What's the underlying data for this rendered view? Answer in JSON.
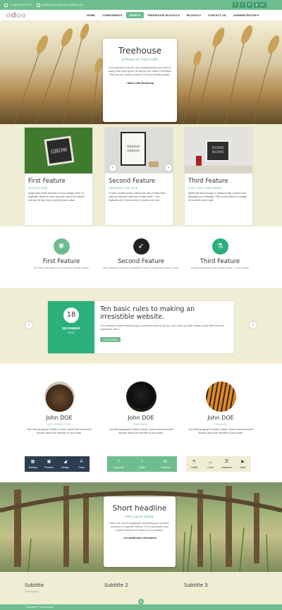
{
  "topbar": {
    "phone": "+1 (650) 691-3277",
    "email": "info@yourcompany.example.com",
    "language": "EN"
  },
  "navbar": {
    "logo_o1": "o",
    "logo_d": "d",
    "logo_rest": "oo",
    "menu": [
      {
        "label": "HOME"
      },
      {
        "label": "COMPONENTS"
      },
      {
        "label": "DEMO ▾"
      },
      {
        "label": "TREEHOUSE BLOCKS ▾"
      },
      {
        "label": "BLOCKS ▾"
      },
      {
        "label": "CONTACT US"
      },
      {
        "label": "ADMINISTRATOR ▾"
      }
    ]
  },
  "hero": {
    "title": "Treehouse",
    "subtitle": "A theme for Odoo CMS",
    "text": "Just drag and drop the new building blocks you need to easily build your layout. All layouts are made of sections, that you can easily combine to fit your specific project.",
    "made_with": "• Made with Bootstrap"
  },
  "features1": {
    "cards": [
      {
        "title": "First Feature",
        "subtitle": "Tell your story",
        "text": "Adapt these three columns to fit you design need. To duplicate, delete or move columns, select the column and use the top icons to perform your action.",
        "img_text": "GROW"
      },
      {
        "title": "Second Feature",
        "subtitle": "Showcase your work",
        "text": "To add a fourth column, reduce the size of these three columns using the right icon of each block. Then, duplicate one of the column to create a new one.",
        "img_text1": "limited",
        "img_text2": "edition"
      },
      {
        "title": "Third Feature",
        "subtitle": "Give some extra details",
        "text": "Delete the above image or replace it with a picture that illustrates your message. Click on the picture to change it's rounded corner style.",
        "img_text1": "HOME",
        "img_text2": "HOME"
      }
    ]
  },
  "features2": {
    "items": [
      {
        "title": "First Feature",
        "text": "Tell what's the value for the customer for this feature.",
        "color": "#6ebd8f",
        "icon": "bug-icon"
      },
      {
        "title": "Second Feature",
        "text": "Write what the customer would like to know, not what you want to show.",
        "color": "#222222",
        "icon": "rocket-icon"
      },
      {
        "title": "Third Feature",
        "text": "A small explanation of this great feature, in clear words.",
        "color": "#2bb07b",
        "icon": "flask-icon"
      }
    ]
  },
  "event": {
    "day": "18",
    "month": "DECEMBER",
    "year": "2014",
    "title": "Ten basic rules to making an irresistible website.",
    "text": "Your website is where almost all your customers will end up first. Let's clean up what it takes to give them the best experience with it.",
    "button": "FULL READ"
  },
  "team": {
    "members": [
      {
        "name": "John DOE",
        "role": "- ART DIRECTOR -",
        "text": "Use this paragraph to write a short, sweet and successful resume about the member of your team."
      },
      {
        "name": "John DOE",
        "role": "- PARTNER -",
        "text": "Use this paragraph to write a short, sweet and successful resume about the member of your team."
      },
      {
        "name": "John DOE",
        "role": "- TRAINEE -",
        "text": "Use this paragraph to write a short, sweet and successful resume about the member of your team."
      }
    ],
    "bar1": [
      {
        "label": "Briefing",
        "icon": "briefcase-icon",
        "glyph": "▦"
      },
      {
        "label": "Pictures",
        "icon": "picture-icon",
        "glyph": "▣"
      },
      {
        "label": "Design",
        "icon": "design-icon",
        "glyph": "◢"
      },
      {
        "label": "Fonts",
        "icon": "font-icon",
        "glyph": "A"
      }
    ],
    "bar2": [
      {
        "label": "Facebook",
        "icon": "facebook-icon",
        "glyph": "f"
      },
      {
        "label": "Twitter",
        "icon": "twitter-icon",
        "glyph": "t"
      },
      {
        "label": "Linkedin",
        "icon": "linkedin-icon",
        "glyph": "in"
      }
    ],
    "bar3": [
      {
        "label": "Coffee",
        "icon": "coffee-icon",
        "glyph": "☕"
      },
      {
        "label": "Code",
        "icon": "code-icon",
        "glyph": "</>"
      },
      {
        "label": "Database",
        "icon": "database-icon",
        "glyph": "☰"
      },
      {
        "label": "Video",
        "icon": "video-icon",
        "glyph": "▶"
      }
    ]
  },
  "short": {
    "title": "Short headline",
    "subtitle": "With a great subtitle",
    "text": "Write one or two paragraphs describing your product, services or a specific feature. To be successful your content needs to be useful to your readers.",
    "add": "• An additional information"
  },
  "footer": {
    "cols": [
      {
        "title": "Subtitle",
        "link": "Homepage"
      },
      {
        "title": "Subtitle 2",
        "link": ""
      },
      {
        "title": "Subtitle 3",
        "link": ""
      }
    ],
    "copyright": "Copyright © YourCompany",
    "totop": "▲"
  },
  "colors": {
    "accent": "#6ebd8f",
    "accent_dark": "#2bb07b",
    "beige": "#efeed5"
  }
}
